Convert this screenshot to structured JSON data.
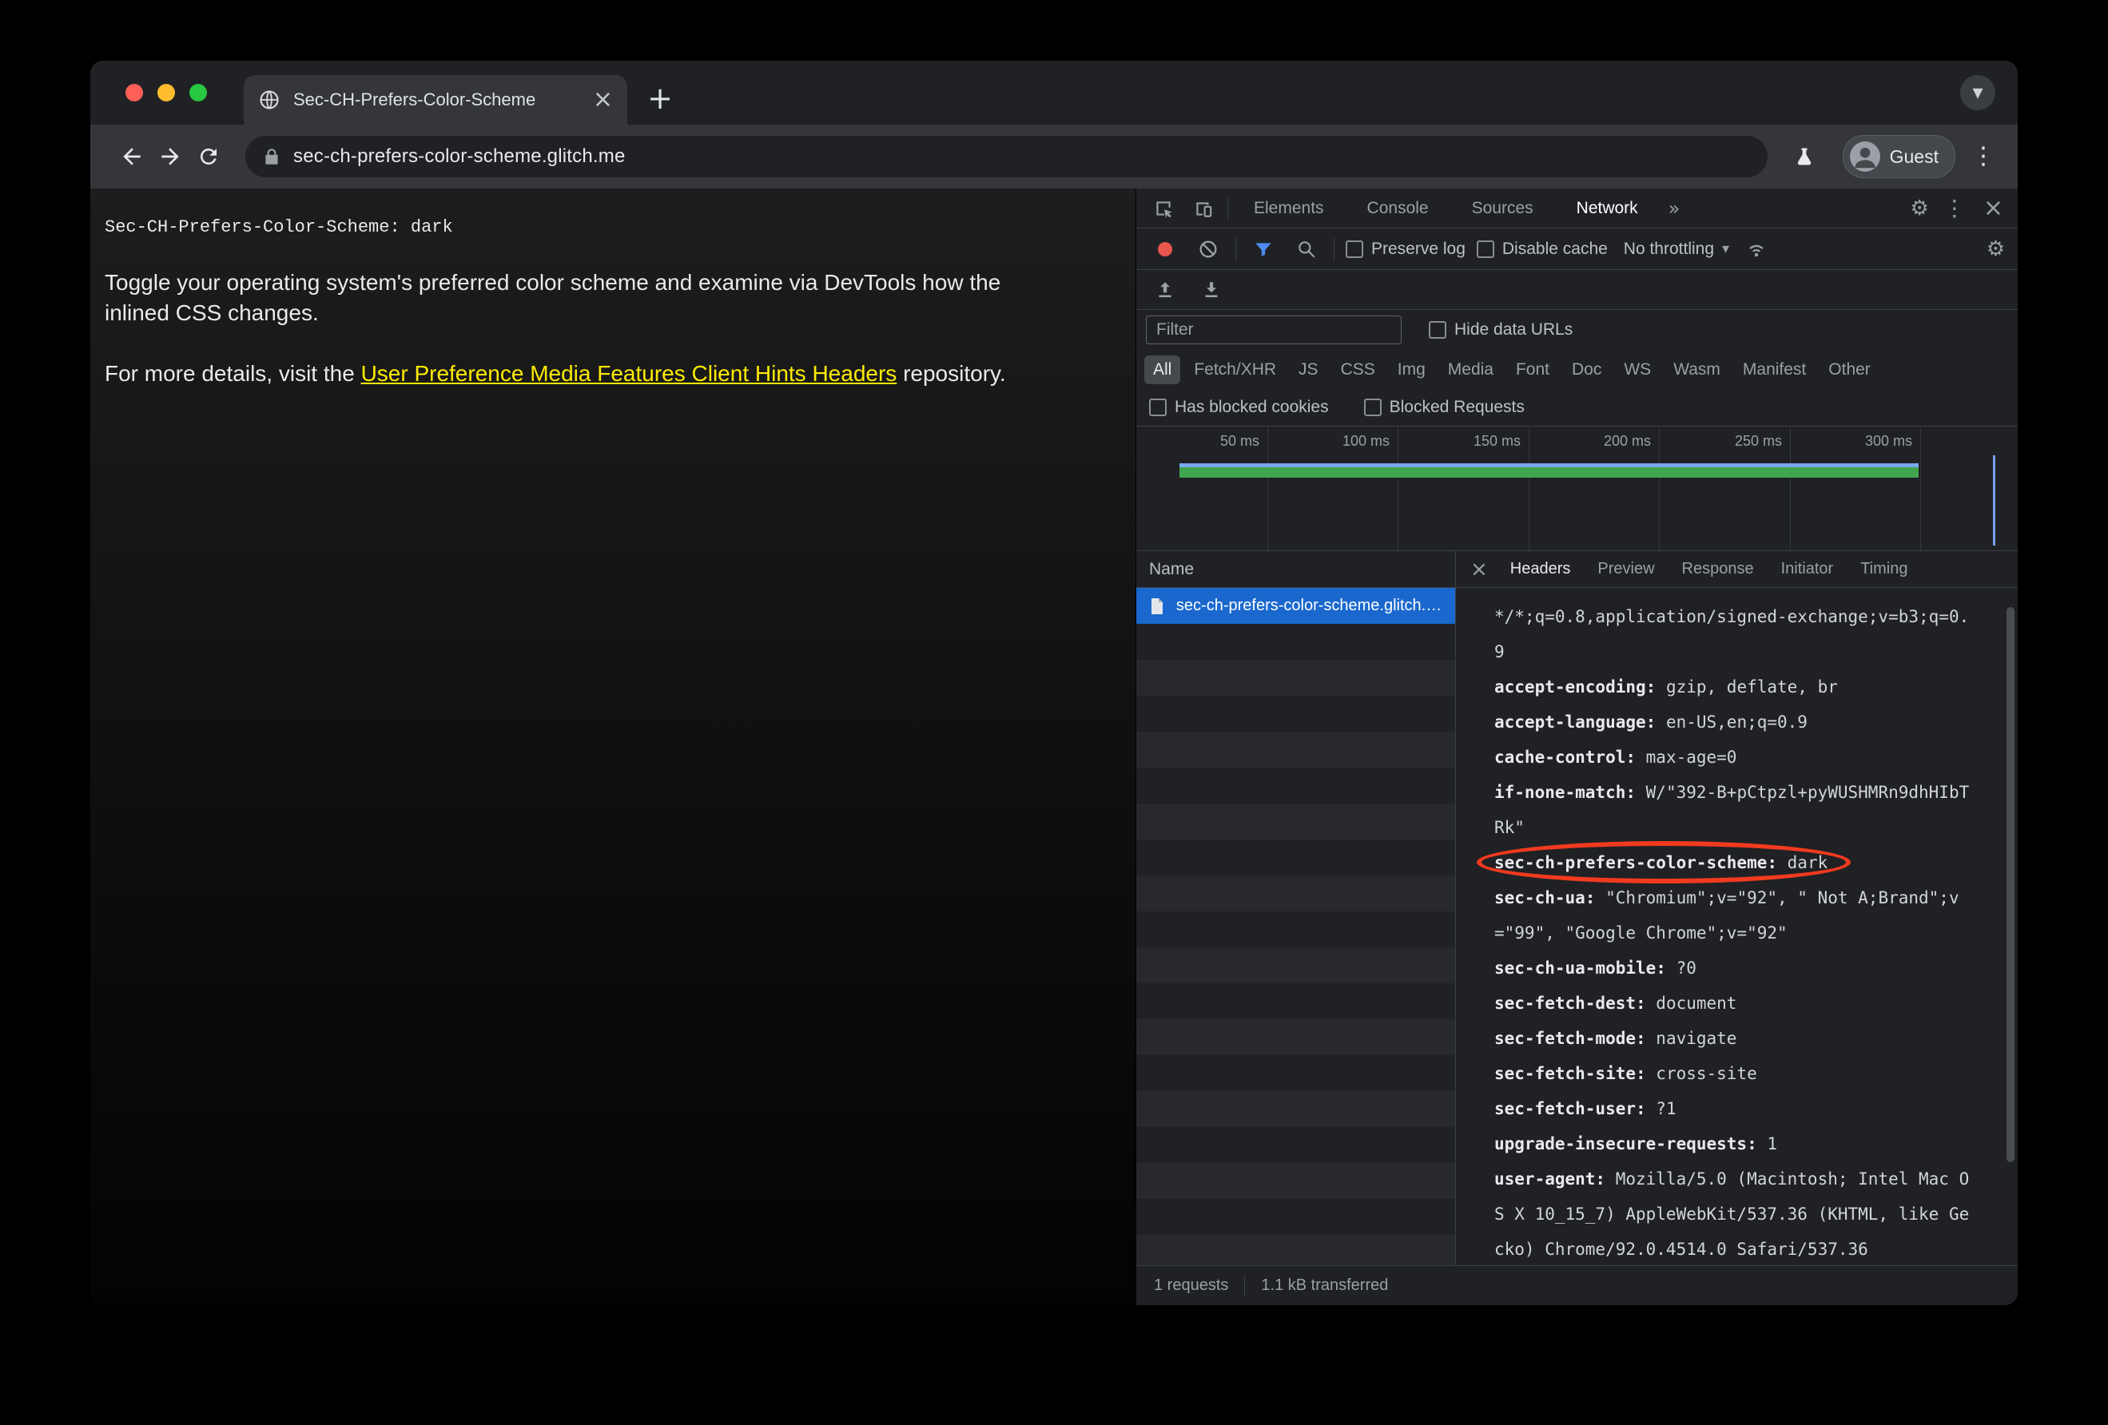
{
  "colors": {
    "window_chrome_bg": "#202124",
    "toolbar_bg": "#35363a",
    "traffic_red": "#ff5f57",
    "traffic_yellow": "#febc2e",
    "traffic_green": "#28c840",
    "page_link_yellow": "#ffeb00",
    "devtools_bg": "#202124",
    "devtools_border": "#3c4043",
    "selected_row_blue": "#1a68ce",
    "record_red": "#e8564d",
    "filter_funnel_blue": "#4e8bf0",
    "overview_green": "#41a44e",
    "overview_blue": "#7aa7f0",
    "annotation_red": "#f23a1f"
  },
  "icons": {
    "tab_close": "×",
    "new_tab": "+",
    "tab_search_chevron": "▾",
    "kebab": "⋮",
    "gear": "⚙",
    "more_panels": "»",
    "caret_down": "▾",
    "devtools_close": "×",
    "details_close": "×"
  },
  "browser": {
    "tab_title": "Sec-CH-Prefers-Color-Scheme",
    "url": "sec-ch-prefers-color-scheme.glitch.me",
    "profile_label": "Guest"
  },
  "page": {
    "code_line": "Sec-CH-Prefers-Color-Scheme: dark",
    "para1": "Toggle your operating system's preferred color scheme and examine via DevTools how the inlined CSS changes.",
    "para2_prefix": "For more details, visit the ",
    "para2_link": "User Preference Media Features Client Hints Headers",
    "para2_suffix": " repository."
  },
  "devtools": {
    "panel_tabs": [
      "Elements",
      "Console",
      "Sources",
      "Network"
    ],
    "active_panel_tab": "Network",
    "netbar": {
      "preserve_log": "Preserve log",
      "disable_cache": "Disable cache",
      "throttling": "No throttling"
    },
    "filter_placeholder": "Filter",
    "hide_data_urls": "Hide data URLs",
    "chips": [
      "All",
      "Fetch/XHR",
      "JS",
      "CSS",
      "Img",
      "Media",
      "Font",
      "Doc",
      "WS",
      "Wasm",
      "Manifest",
      "Other"
    ],
    "active_chip": "All",
    "has_blocked_cookies": "Has blocked cookies",
    "blocked_requests": "Blocked Requests",
    "timeline_ticks": [
      "50 ms",
      "100 ms",
      "150 ms",
      "200 ms",
      "250 ms",
      "300 ms"
    ],
    "requests": {
      "name_header": "Name",
      "row_name": "sec-ch-prefers-color-scheme.glitch.me"
    },
    "details_tabs": [
      "Headers",
      "Preview",
      "Response",
      "Initiator",
      "Timing"
    ],
    "active_details_tab": "Headers",
    "headers": [
      {
        "name": "",
        "value": "*/*;q=0.8,application/signed-exchange;v=b3;q=0.9"
      },
      {
        "name": "accept-encoding: ",
        "value": "gzip, deflate, br"
      },
      {
        "name": "accept-language: ",
        "value": "en-US,en;q=0.9"
      },
      {
        "name": "cache-control: ",
        "value": "max-age=0"
      },
      {
        "name": "if-none-match: ",
        "value": "W/\"392-B+pCtpzl+pyWUSHMRn9dhHIbTRk\""
      },
      {
        "name": "sec-ch-prefers-color-scheme: ",
        "value": "dark",
        "highlighted": true
      },
      {
        "name": "sec-ch-ua: ",
        "value": "\"Chromium\";v=\"92\", \" Not A;Brand\";v=\"99\", \"Google Chrome\";v=\"92\""
      },
      {
        "name": "sec-ch-ua-mobile: ",
        "value": "?0"
      },
      {
        "name": "sec-fetch-dest: ",
        "value": "document"
      },
      {
        "name": "sec-fetch-mode: ",
        "value": "navigate"
      },
      {
        "name": "sec-fetch-site: ",
        "value": "cross-site"
      },
      {
        "name": "sec-fetch-user: ",
        "value": "?1"
      },
      {
        "name": "upgrade-insecure-requests: ",
        "value": "1"
      },
      {
        "name": "user-agent: ",
        "value": "Mozilla/5.0 (Macintosh; Intel Mac OS X 10_15_7) AppleWebKit/537.36 (KHTML, like Gecko) Chrome/92.0.4514.0 Safari/537.36"
      }
    ],
    "status": {
      "requests_count": "1 requests",
      "transferred": "1.1 kB transferred"
    }
  }
}
